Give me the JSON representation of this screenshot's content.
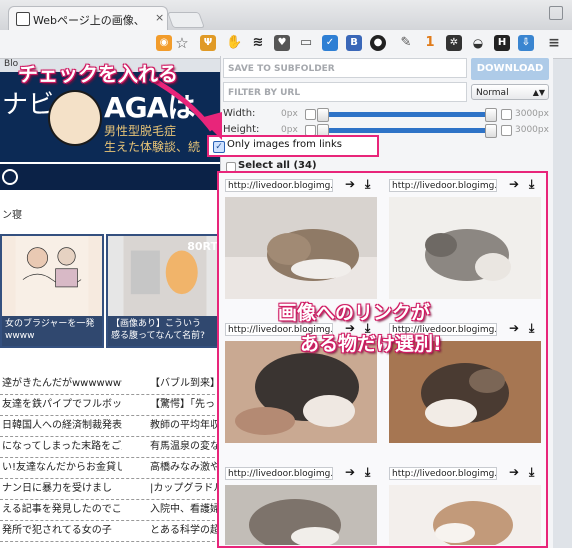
{
  "browser": {
    "tab_title": "Webページ上の画像、リンク",
    "close_glyph": "×"
  },
  "bookmarks": {
    "first": "Blo"
  },
  "page": {
    "navi": "ナビ",
    "aga": "AGAは",
    "tagline1": "男性型脱毛症",
    "tagline2": "生えた体験談、続",
    "crumb": "ン寝",
    "thumb1_caption": "女のブラジャーを一発\nwwww",
    "thumb2_caption": "【画像あり】こういう\n感る腹ってなんて名前?",
    "thumb2_badge": "80RT",
    "rows": [
      {
        "left": "逹がきたんだがwwwwwww",
        "right": "【バブル到来】"
      },
      {
        "left": "友達を鉄パイプでフルボッコ",
        "right": "【驚愕】「先っ"
      },
      {
        "left": "日韓国人への経済制裁発表",
        "right": "教師の平均年収"
      },
      {
        "left": "になってしまった末路をご覧",
        "right": "有馬温泉の変な"
      },
      {
        "left": "い!友達なんだからお金貸し",
        "right": "高橋みなみ激や"
      },
      {
        "left": "ナン日に暴力を受けまし",
        "right": "|カップグラドル"
      },
      {
        "left": "える記事を発見したのでここ",
        "right": "入院中、看護婦"
      },
      {
        "left": "発所で犯されてる女の子",
        "right": "とある科学の超"
      }
    ]
  },
  "popup": {
    "subfolder_placeholder": "SAVE TO SUBFOLDER",
    "filter_placeholder": "FILTER BY URL",
    "download_label": "DOWNLOAD",
    "mode_value": "Normal",
    "width_label": "Width:",
    "height_label": "Height:",
    "min_px": "0px",
    "max_px": "3000px",
    "only_links_label": "Only images from links",
    "only_links_checked": true,
    "select_all_label": "Select all (34)",
    "images": [
      {
        "url": "http://livedoor.blogimg.jp"
      },
      {
        "url": "http://livedoor.blogimg.jp"
      },
      {
        "url": "http://livedoor.blogimg.jp"
      },
      {
        "url": "http://livedoor.blogimg.jp"
      },
      {
        "url": "http://livedoor.blogimg.jp"
      },
      {
        "url": "http://livedoor.blogimg.jp"
      }
    ],
    "open_glyph": "➔",
    "download_glyph": "⤓"
  },
  "annotations": {
    "check_note": "チェックを入れる",
    "result_line1": "画像へのリンクが",
    "result_line2": "ある物だけ選別!"
  },
  "colors": {
    "accent_pink": "#e8257a",
    "slider_blue": "#2e73c7",
    "download_btn": "#aecbe8"
  }
}
